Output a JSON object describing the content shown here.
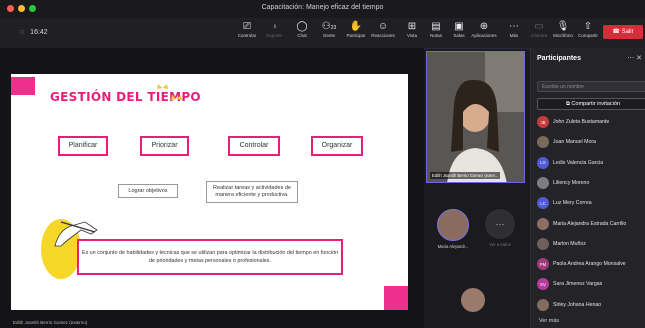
{
  "window": {
    "title": "Capacitación: Manejo eficaz del tiempo",
    "dot_colors": [
      "#ff5f57",
      "#febc2e",
      "#28c840"
    ]
  },
  "toolbar": {
    "timer": "16:42",
    "buttons": [
      {
        "label": "Controlar",
        "icon": "screen-control-icon",
        "glyph": "⎚",
        "dim": false
      },
      {
        "label": "Soporte",
        "icon": "support-icon",
        "glyph": "◑",
        "dim": true
      },
      {
        "label": "Chat",
        "icon": "chat-icon",
        "glyph": "◯",
        "dim": false
      },
      {
        "label": "Gente",
        "icon": "people-icon",
        "glyph": "⚇",
        "dim": false,
        "count": "23"
      },
      {
        "label": "Participar",
        "icon": "raise-hand-icon",
        "glyph": "✋",
        "dim": false
      },
      {
        "label": "Reacciones",
        "icon": "reactions-icon",
        "glyph": "☺",
        "dim": false
      },
      {
        "label": "Vista",
        "icon": "view-icon",
        "glyph": "⊞",
        "dim": false
      },
      {
        "label": "Notas",
        "icon": "notes-icon",
        "glyph": "▤",
        "dim": false
      },
      {
        "label": "Salas",
        "icon": "rooms-icon",
        "glyph": "▣",
        "dim": false
      },
      {
        "label": "Aplicaciones",
        "icon": "apps-icon",
        "glyph": "⊕",
        "dim": false
      },
      {
        "label": "Más",
        "icon": "more-icon",
        "glyph": "⋯",
        "dim": false
      },
      {
        "label": "Cámara",
        "icon": "camera-off-icon",
        "glyph": "▭",
        "dim": true
      },
      {
        "label": "Micrófono",
        "icon": "mic-off-icon",
        "glyph": "🎙",
        "dim": false
      },
      {
        "label": "Compartir",
        "icon": "share-icon",
        "glyph": "⇧",
        "dim": false
      }
    ],
    "leave_label": "Salir"
  },
  "slide": {
    "title": "GESTIÓN DEL TIEMPO",
    "boxes": [
      "Planificar",
      "Priorizar",
      "Controlar",
      "Organizar"
    ],
    "goal": "Lograr objetivos",
    "task": "Realizar tareas y actividades de manera eficiente y productiva.",
    "definition": "Es un conjunto de habilidades y técnicas que se utilizan para optimizar la distribución del tiempo en función de prioridades y metas personales o profesionales.",
    "accent_color": "#e91e7a"
  },
  "stage": {
    "speaker_label": "Edith Joanith Berrio Gomez (externo)"
  },
  "video": {
    "name": "Edith Joanith Berrio Gomez (exter..."
  },
  "tiles": [
    {
      "name": "Maria Alejandr..."
    },
    {
      "name": "Ver a todos"
    }
  ],
  "participants": {
    "title": "Participantes",
    "search_placeholder": "Escribe un nombre",
    "share_invite": "Compartir invitación",
    "items": [
      {
        "name": "John Zuleta Bustamante",
        "initials": "JB",
        "color": "#c43c3c"
      },
      {
        "name": "Juan Manuel Mora",
        "initials": "",
        "color": "#7a6a5a"
      },
      {
        "name": "Ledis Valencia Garcia",
        "initials": "LG",
        "color": "#4f5bd5"
      },
      {
        "name": "Liliency Moreno",
        "initials": "",
        "color": "#7d7d86"
      },
      {
        "name": "Luz Mery Correa",
        "initials": "LC",
        "color": "#4f5bd5"
      },
      {
        "name": "Maria Alejandra Estrada Carrillo",
        "initials": "",
        "color": "#8c6f64"
      },
      {
        "name": "Marlon Muñoz",
        "initials": "",
        "color": "#6f5e59"
      },
      {
        "name": "Paola Andrea Arango Monsalve",
        "initials": "PM",
        "color": "#a13c7d"
      },
      {
        "name": "Sara Jimenez Vargas",
        "initials": "SV",
        "color": "#b63ba0"
      },
      {
        "name": "Sirley Johana Henao",
        "initials": "",
        "color": "#806c60"
      }
    ],
    "more": "Ver más"
  }
}
